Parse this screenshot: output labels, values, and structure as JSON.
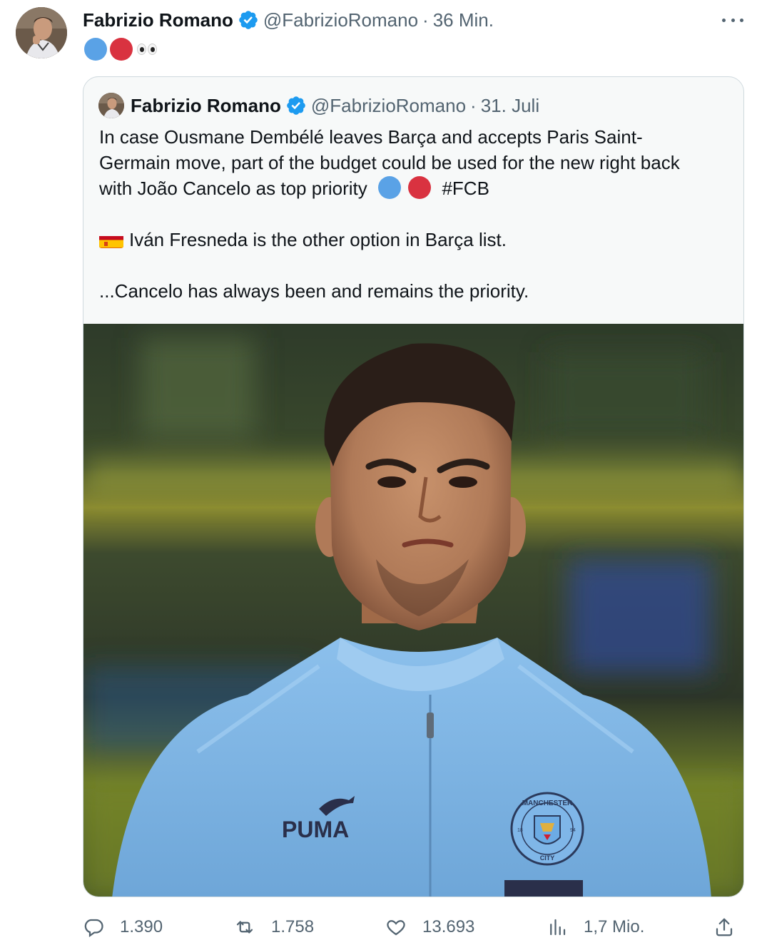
{
  "tweet": {
    "author_name": "Fabrizio Romano",
    "handle": "@FabrizioRomano",
    "separator": "·",
    "time": "36 Min.",
    "text_emojis": [
      "blue-circle",
      "red-circle",
      "eyes"
    ]
  },
  "quoted_tweet": {
    "author_name": "Fabrizio Romano",
    "handle": "@FabrizioRomano",
    "separator": "·",
    "date": "31. Juli",
    "paragraph1_line1": "In case Ousmane Dembélé leaves Barça and accepts Paris Saint-",
    "paragraph1_line2": "Germain move, part of the budget could be used for the new right back",
    "paragraph1_line3": "with João Cancelo as top priority",
    "hashtag": "#FCB",
    "paragraph2": "Iván Fresneda is the other option in Barça list.",
    "paragraph3": "...Cancelo has always been and remains the priority.",
    "photo": {
      "jacket_brand": "PUMA",
      "crest_text_top": "MANCHESTER",
      "crest_text_bottom": "CITY",
      "crest_year_left": "18",
      "crest_year_right": "94"
    }
  },
  "actions": {
    "replies": "1.390",
    "reposts": "1.758",
    "likes": "13.693",
    "views": "1,7 Mio."
  },
  "colors": {
    "blue_circle": "#5aa2e6",
    "red_circle": "#d93240",
    "verified": "#1d9bf0",
    "secondary_text": "#536471",
    "jacket": "#7fb6e8"
  }
}
